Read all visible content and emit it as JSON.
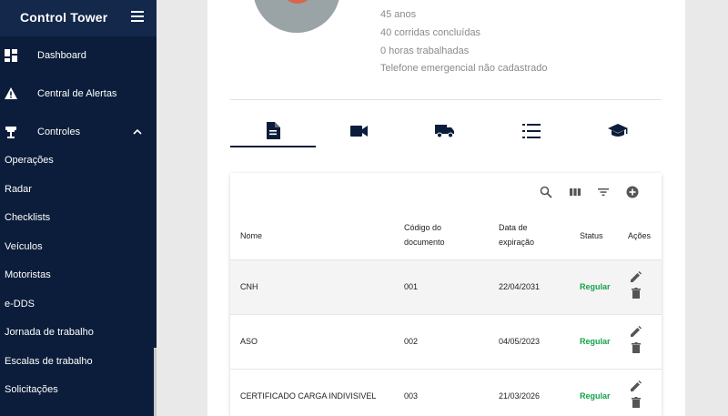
{
  "sidebar": {
    "title": "Control Tower",
    "main_items": [
      {
        "label": "Dashboard",
        "icon": "dashboard-icon"
      },
      {
        "label": "Central de Alertas",
        "icon": "warning-icon"
      },
      {
        "label": "Controles",
        "icon": "tower-icon",
        "expanded": true
      }
    ],
    "sub_items": [
      "Operações",
      "Radar",
      "Checklists",
      "Veículos",
      "Motoristas",
      "e-DDS",
      "Jornada de trabalho",
      "Escalas de trabalho",
      "Solicitações"
    ]
  },
  "profile": {
    "lines": [
      "45 anos",
      "40 corridas concluídas",
      "0 horas trabalhadas",
      "Telefone emergencial não cadastrado"
    ]
  },
  "tabs": [
    {
      "icon": "document-icon",
      "active": true
    },
    {
      "icon": "video-camera-icon",
      "active": false
    },
    {
      "icon": "truck-icon",
      "active": false
    },
    {
      "icon": "checklist-icon",
      "active": false
    },
    {
      "icon": "graduation-cap-icon",
      "active": false
    }
  ],
  "table": {
    "toolbar": [
      "search-icon",
      "columns-icon",
      "filter-icon",
      "add-icon"
    ],
    "headers": {
      "nome": "Nome",
      "codigo_1": "Código do",
      "codigo_2": "documento",
      "data_1": "Data de",
      "data_2": "expiração",
      "status": "Status",
      "acoes": "Ações"
    },
    "rows": [
      {
        "nome": "CNH",
        "codigo": "001",
        "data": "22/04/2031",
        "status": "Regular"
      },
      {
        "nome": "ASO",
        "codigo": "002",
        "data": "04/05/2023",
        "status": "Regular"
      },
      {
        "nome": "CERTIFICADO CARGA INDIVISIVEL",
        "codigo": "003",
        "data": "21/03/2026",
        "status": "Regular"
      }
    ]
  },
  "colors": {
    "sidebar_bg": "#0b1d3a",
    "status_green": "#13a34a",
    "icon_navy": "#0b1d3a"
  }
}
